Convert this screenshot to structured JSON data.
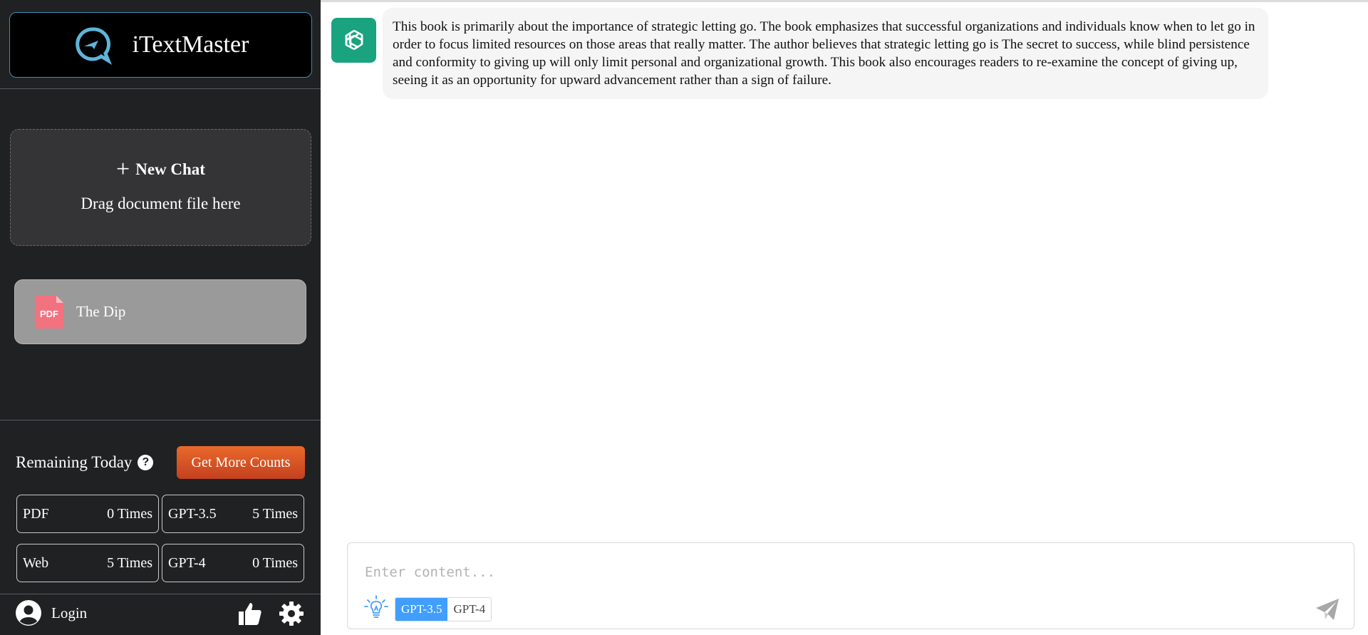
{
  "app": {
    "name": "iTextMaster"
  },
  "sidebar": {
    "new_chat_label": "New Chat",
    "drag_hint": "Drag document file here",
    "documents": [
      {
        "name": "The Dip",
        "type_badge": "PDF"
      }
    ],
    "remaining_label": "Remaining Today",
    "help_glyph": "?",
    "get_more_label": "Get More Counts",
    "counts": [
      {
        "label": "PDF",
        "value": "0 Times"
      },
      {
        "label": "GPT-3.5",
        "value": "5 Times"
      },
      {
        "label": "Web",
        "value": "5 Times"
      },
      {
        "label": "GPT-4",
        "value": "0 Times"
      }
    ],
    "login_label": "Login"
  },
  "chat": {
    "messages": [
      {
        "role": "assistant",
        "text": "This book is primarily about the importance of strategic letting go. The book emphasizes that successful organizations and individuals know when to let go in order to focus limited resources on those areas that really matter. The author believes that strategic letting go is The secret to success, while blind persistence and conformity to giving up will only limit personal and organizational growth. This book also encourages readers to re-examine the concept of giving up, seeing it as an opportunity for upward advancement rather than a sign of failure."
      }
    ]
  },
  "composer": {
    "placeholder": "Enter content...",
    "models": [
      "GPT-3.5",
      "GPT-4"
    ],
    "selected_model": "GPT-3.5"
  },
  "colors": {
    "sidebar_bg": "#202123",
    "accent_blue": "#409eff",
    "assistant_avatar": "#19a37f",
    "get_more_button": "#d9552a",
    "pdf_badge": "#f3727f"
  }
}
